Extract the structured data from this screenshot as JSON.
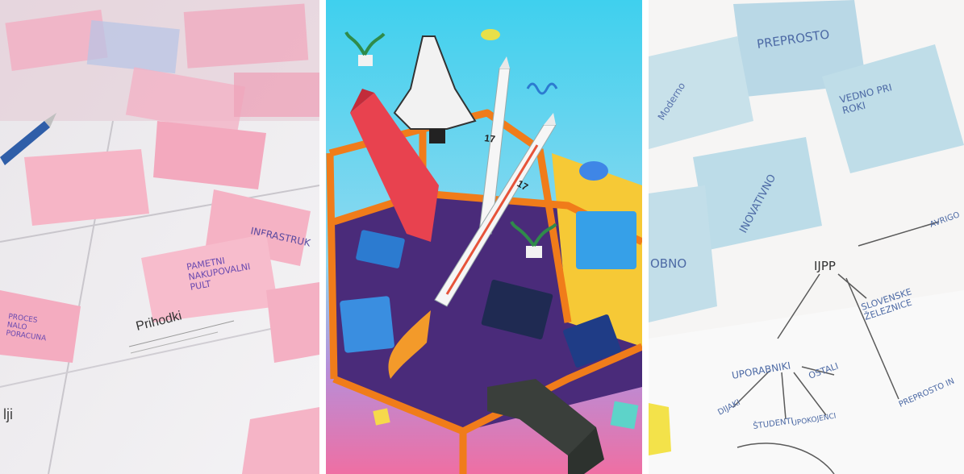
{
  "collage": {
    "left_photo": {
      "heading": "Prihodki",
      "notes": [
        "PAMETNI\nNAKUPOVALNI\nPULT",
        "INFRASTRUK",
        "PROCES\nNALO\nPORACUNA"
      ],
      "margin_text": "lji"
    },
    "middle_illustration": {
      "rocket_number": "17"
    },
    "right_photo": {
      "notes": [
        "PREPROSTO",
        "VEDNO  PRI\nROKI",
        "Moderno",
        "INOVATIVNO",
        "OBNO"
      ],
      "mindmap": {
        "center": "IJPP",
        "branches": [
          "AVRIGO",
          "SLOVENSKE\nŽELEZNICE",
          "UPORABNIKI",
          "DIJAKI",
          "ŠTUDENTI",
          "UPOKOJENCI",
          "OSTALI",
          "PREPROSTO IN"
        ]
      }
    }
  }
}
